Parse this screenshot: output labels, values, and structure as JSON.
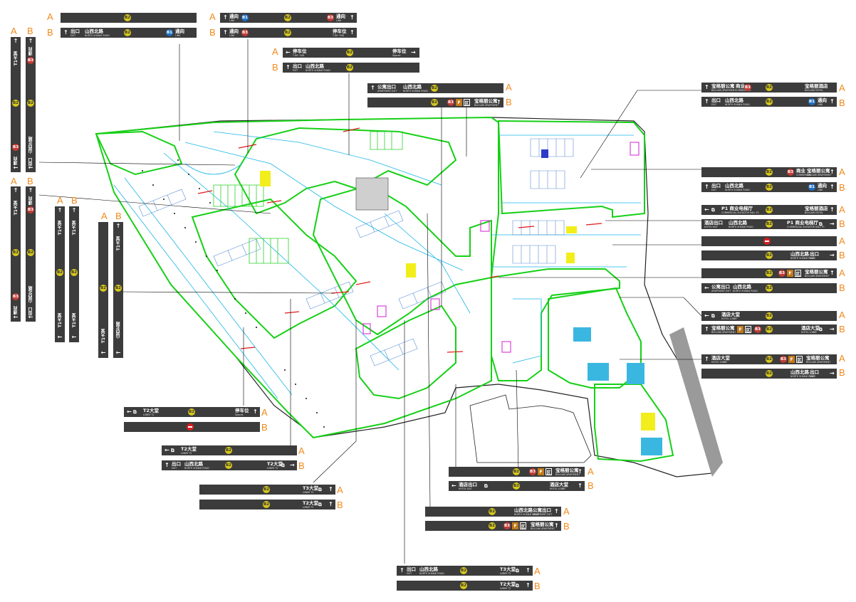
{
  "labels": {
    "a": "A",
    "b": "B"
  },
  "text": {
    "b2": "B2",
    "b1": "B1",
    "b3": "B3",
    "f": "F",
    "qu": "区",
    "toward": "通向",
    "towardEn": "LINK",
    "exit": "出口",
    "shanxi": "山西北路",
    "shanxiEn": "NORTH SHANXI ROAD",
    "exitEn": "EXIT",
    "parking": "停车位",
    "parkingA": "T 60~308",
    "parkingB": "Spaces",
    "hotelExit": "酒店出口",
    "hotelExitEn": "HOTEL EXIT",
    "aptExit": "公寓出口",
    "aptExitEn": "APARTMENT EXIT",
    "hotelHall": "酒店大堂",
    "hotelHallEn": "HOTEL LOBBY",
    "baoli": "宝格丽公寓",
    "baoliEn": "BULGARI APARTMENT",
    "baoliHotel": "宝格丽酒店",
    "baoliHotelEn": "BULGARI HOTEL",
    "commercial": "商业",
    "commercialEn": "COMMERCIAL",
    "p1": "P1 商业电梯厅",
    "p1En": "COMMERCIAL ELEVATOR HALL P1",
    "t1": "T1大堂",
    "t1En": "LOBBY T1",
    "t2": "T2大堂",
    "t2En": "LOBBY T2",
    "t3": "T3大堂",
    "t3En": "LOBBY T3",
    "aptHall": "公寓大堂",
    "aptHallEn": "APARTMENT LOBBY"
  },
  "colors": {
    "sign": "#3c3c3c",
    "b2": "#d6c81c",
    "b1": "#1f6fc1",
    "b3": "#c23b36",
    "letter": "#f08a1c",
    "zone": "#16d016",
    "road": "#1ab5e6"
  },
  "icons": [
    "arrow-up-icon",
    "arrow-left-icon",
    "arrow-right-icon",
    "no-entry-icon",
    "elevator-icon"
  ]
}
